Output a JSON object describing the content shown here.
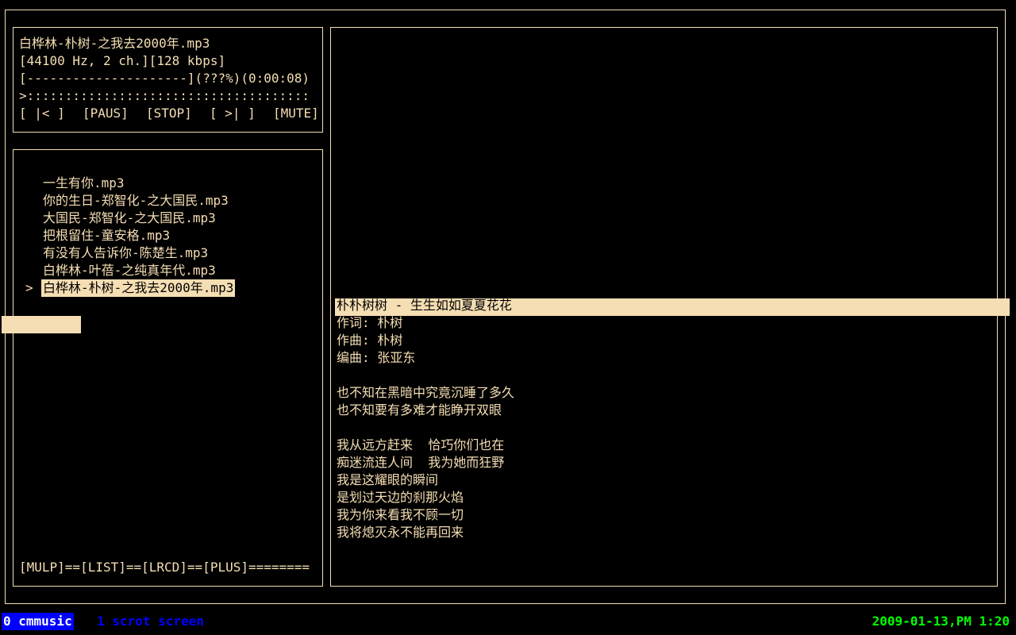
{
  "now_playing": {
    "title": "白桦林-朴树-之我去2000年.mp3",
    "format": "[44100 Hz, 2 ch.][128 kbps]",
    "progress": "[---------------------](???%)(0:00:08)",
    "volume_bar": ">:::::::::::::::::::::::::::::::::::::",
    "controls": {
      "prev": "[ |< ]",
      "pause": "[PAUS]",
      "stop": "[STOP]",
      "next": "[ >| ]",
      "mute": "[MUTE]"
    }
  },
  "playlist": {
    "cursor": ">",
    "items": [
      "一生有你.mp3",
      "你的生日-郑智化-之大国民.mp3",
      "大国民-郑智化-之大国民.mp3",
      "把根留住-童安格.mp3",
      "有没有人告诉你-陈楚生.mp3",
      "白桦林-叶蓓-之纯真年代.mp3",
      "白桦林-朴树-之我去2000年.mp3"
    ],
    "selected_index": 6
  },
  "view_tabs": "[MULP]==[LIST]==[LRCD]==[PLUS]========",
  "lyrics": {
    "current": "朴朴树树 - 生生如如夏夏花花",
    "lines": [
      "作词: 朴树",
      "作曲: 朴树",
      "编曲: 张亚东",
      "",
      "也不知在黑暗中究竟沉睡了多久",
      "也不知要有多难才能睁开双眼",
      "",
      "我从远方赶来  恰巧你们也在",
      "痴迷流连人间  我为她而狂野",
      "我是这耀眼的瞬间",
      "是划过天边的刹那火焰",
      "我为你来看我不顾一切",
      "我将熄灭永不能再回来"
    ]
  },
  "statusbar": {
    "window_0": "0 cmmusic",
    "window_1": "1 scrot screen",
    "clock": "2009-01-13,PM 1:20"
  },
  "colors": {
    "foreground": "#f5deb3",
    "background": "#000000",
    "active_window": "#0000ff",
    "clock": "#00ff00"
  }
}
